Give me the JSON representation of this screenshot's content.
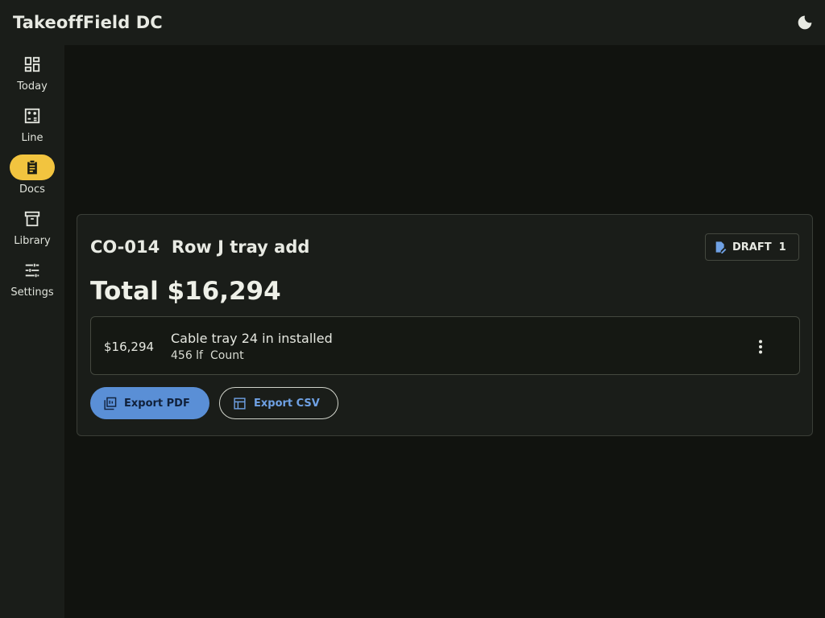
{
  "app": {
    "title": "TakeoffField DC"
  },
  "topbar": {
    "theme_icon": "moon-icon"
  },
  "sidebar": {
    "items": [
      {
        "label": "Today",
        "icon": "dashboard-icon",
        "active": false
      },
      {
        "label": "Line",
        "icon": "calculator-icon",
        "active": false
      },
      {
        "label": "Docs",
        "icon": "clipboard-icon",
        "active": true
      },
      {
        "label": "Library",
        "icon": "archive-icon",
        "active": false
      },
      {
        "label": "Settings",
        "icon": "sliders-icon",
        "active": false
      }
    ]
  },
  "change_order": {
    "title": "CO-014  Row J tray add",
    "status": {
      "label": "DRAFT",
      "count": "1",
      "icon": "edit-document-icon"
    },
    "total": "Total $16,294",
    "line_items": [
      {
        "amount": "$16,294",
        "description": "Cable tray 24 in installed",
        "quantity": "456 lf",
        "method": "Count"
      }
    ],
    "actions": {
      "export_pdf": "Export PDF",
      "export_csv": "Export CSV"
    }
  },
  "colors": {
    "accent_active": "#f2c43f",
    "primary_button": "#5a8fd6",
    "link_blue": "#6fa1e4",
    "surface": "#1a1d19",
    "background": "#11130f"
  }
}
